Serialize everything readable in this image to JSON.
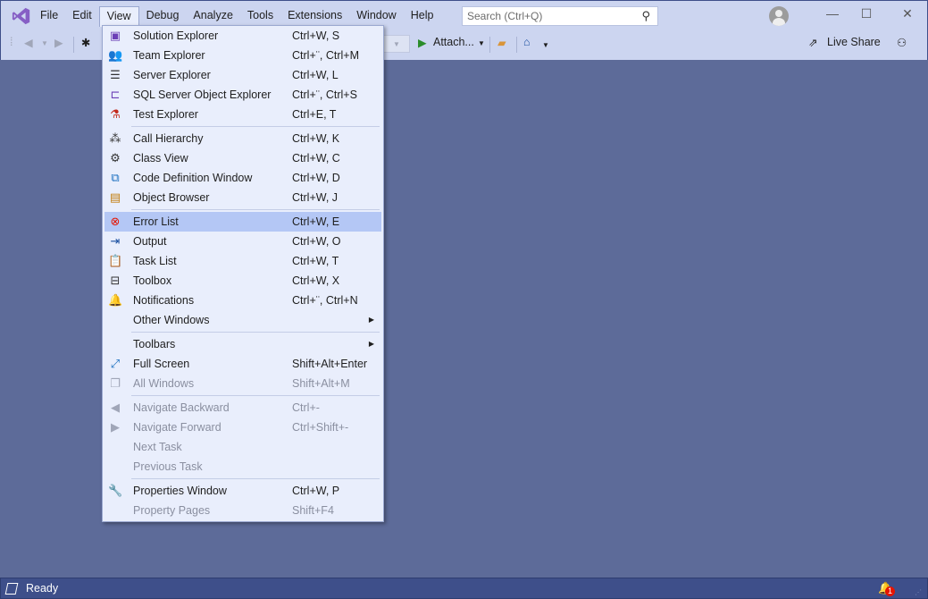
{
  "titlebar": {
    "menu": [
      "File",
      "Edit",
      "View",
      "Debug",
      "Analyze",
      "Tools",
      "Extensions",
      "Window",
      "Help"
    ],
    "open_menu": "View",
    "search_placeholder": "Search (Ctrl+Q)",
    "icons": {
      "search": "magnifier-icon",
      "account": "user-avatar-icon"
    }
  },
  "toolbar": {
    "attach_label": "Attach...",
    "live_share_label": "Live Share"
  },
  "view_menu": [
    {
      "label": "Solution Explorer",
      "shortcut": "Ctrl+W, S",
      "icon": "solution-explorer-icon",
      "glyph": "▣",
      "color": "#6c3fb6"
    },
    {
      "label": "Team Explorer",
      "shortcut": "Ctrl+¨, Ctrl+M",
      "icon": "team-explorer-icon",
      "glyph": "👥",
      "color": "#333"
    },
    {
      "label": "Server Explorer",
      "shortcut": "Ctrl+W, L",
      "icon": "server-explorer-icon",
      "glyph": "☰",
      "color": "#333"
    },
    {
      "label": "SQL Server Object Explorer",
      "shortcut": "Ctrl+¨, Ctrl+S",
      "icon": "sql-server-icon",
      "glyph": "⊏",
      "color": "#6c3fb6"
    },
    {
      "label": "Test Explorer",
      "shortcut": "Ctrl+E, T",
      "icon": "test-explorer-icon",
      "glyph": "⚗",
      "color": "#c42b1c"
    },
    {
      "sep": true
    },
    {
      "label": "Call Hierarchy",
      "shortcut": "Ctrl+W, K",
      "icon": "call-hierarchy-icon",
      "glyph": "⁂",
      "color": "#333"
    },
    {
      "label": "Class View",
      "shortcut": "Ctrl+W, C",
      "icon": "class-view-icon",
      "glyph": "⚙",
      "color": "#333"
    },
    {
      "label": "Code Definition Window",
      "shortcut": "Ctrl+W, D",
      "icon": "code-definition-icon",
      "glyph": "⧉",
      "color": "#1a6fc0"
    },
    {
      "label": "Object Browser",
      "shortcut": "Ctrl+W, J",
      "icon": "object-browser-icon",
      "glyph": "▤",
      "color": "#c27d0e"
    },
    {
      "sep": true
    },
    {
      "label": "Error List",
      "shortcut": "Ctrl+W, E",
      "icon": "error-list-icon",
      "glyph": "⊗",
      "color": "#e51400",
      "highlighted": true
    },
    {
      "label": "Output",
      "shortcut": "Ctrl+W, O",
      "icon": "output-icon",
      "glyph": "⇥",
      "color": "#1a4fa0"
    },
    {
      "label": "Task List",
      "shortcut": "Ctrl+W, T",
      "icon": "task-list-icon",
      "glyph": "📋",
      "color": "#c27d0e"
    },
    {
      "label": "Toolbox",
      "shortcut": "Ctrl+W, X",
      "icon": "toolbox-icon",
      "glyph": "⊟",
      "color": "#333"
    },
    {
      "label": "Notifications",
      "shortcut": "Ctrl+¨, Ctrl+N",
      "icon": "bell-icon",
      "glyph": "🔔",
      "color": "#333"
    },
    {
      "label": "Other Windows",
      "submenu": true
    },
    {
      "sep": true
    },
    {
      "label": "Toolbars",
      "submenu": true
    },
    {
      "label": "Full Screen",
      "shortcut": "Shift+Alt+Enter",
      "icon": "full-screen-icon",
      "glyph": "⤢",
      "color": "#1a6fc0"
    },
    {
      "label": "All Windows",
      "shortcut": "Shift+Alt+M",
      "icon": "all-windows-icon",
      "glyph": "❐",
      "color": "#a0a6b8",
      "disabled": true
    },
    {
      "sep": true
    },
    {
      "label": "Navigate Backward",
      "shortcut": "Ctrl+-",
      "icon": "navigate-back-icon",
      "glyph": "◀",
      "color": "#a0a6b8",
      "disabled": true
    },
    {
      "label": "Navigate Forward",
      "shortcut": "Ctrl+Shift+-",
      "icon": "navigate-forward-icon",
      "glyph": "▶",
      "color": "#a0a6b8",
      "disabled": true
    },
    {
      "label": "Next Task",
      "disabled": true
    },
    {
      "label": "Previous Task",
      "disabled": true
    },
    {
      "sep": true
    },
    {
      "label": "Properties Window",
      "shortcut": "Ctrl+W, P",
      "icon": "wrench-icon",
      "glyph": "🔧",
      "color": "#333"
    },
    {
      "label": "Property Pages",
      "shortcut": "Shift+F4",
      "disabled": true
    }
  ],
  "statusbar": {
    "status": "Ready",
    "notification_count": "1"
  },
  "colors": {
    "background": "#5d6b99",
    "titlebar": "#ccd5f0",
    "menu": "#e9eefc",
    "highlight": "#b4c7f5",
    "statusbar": "#3e4f8a"
  }
}
